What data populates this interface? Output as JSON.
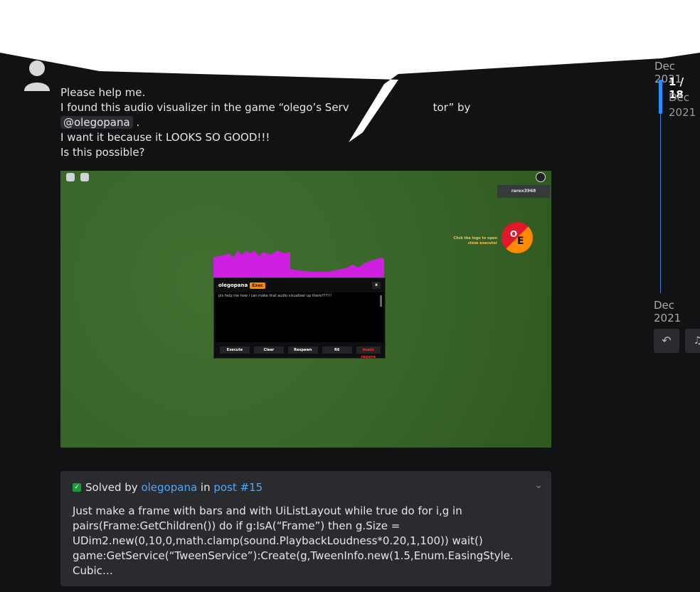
{
  "timeline": {
    "top_date": "Dec 2021",
    "count": "1 / 18",
    "current_date": "Dec 2021",
    "bottom_date": "Dec 2021"
  },
  "post": {
    "lines": [
      "Please help me.",
      "I found this audio visualizer in the game “olego’s Serv",
      "tor” by",
      "I want it because it LOOKS SO GOOD!!!",
      "Is this possible?"
    ],
    "mention": "@olegopana"
  },
  "game_screenshot": {
    "player_name": "rarex3968",
    "logo_hint": "Click the logo to open close executor",
    "executor_title": "olegopana",
    "executor_badge": "Exec",
    "executor_close": "x",
    "executor_text": "pls help me how i can make that audio visualiser up there???!!!",
    "buttons": [
      "Execute",
      "Clear",
      "Respawn",
      "R6",
      "music require"
    ]
  },
  "solution": {
    "prefix": "Solved by",
    "author": "olegopana",
    "in_text": "in",
    "post_link": "post #15",
    "excerpt": "Just make a frame with bars and with UiListLayout while true do for i,g in pairs(Frame:GetChildren()) do if g:IsA(“Frame”) then g.Size = UDim2.new(0,10,0,math.clamp(sound.PlaybackLoudness*0.20,1,100)) wait() game:GetService(“TweenService”):Create(g,TweenInfo.new(1.5,Enum.EasingStyle. Cubic…"
  },
  "icons": {
    "reply": "reply-icon",
    "bell": "bell-icon",
    "chevron": "chevron-down-icon"
  }
}
